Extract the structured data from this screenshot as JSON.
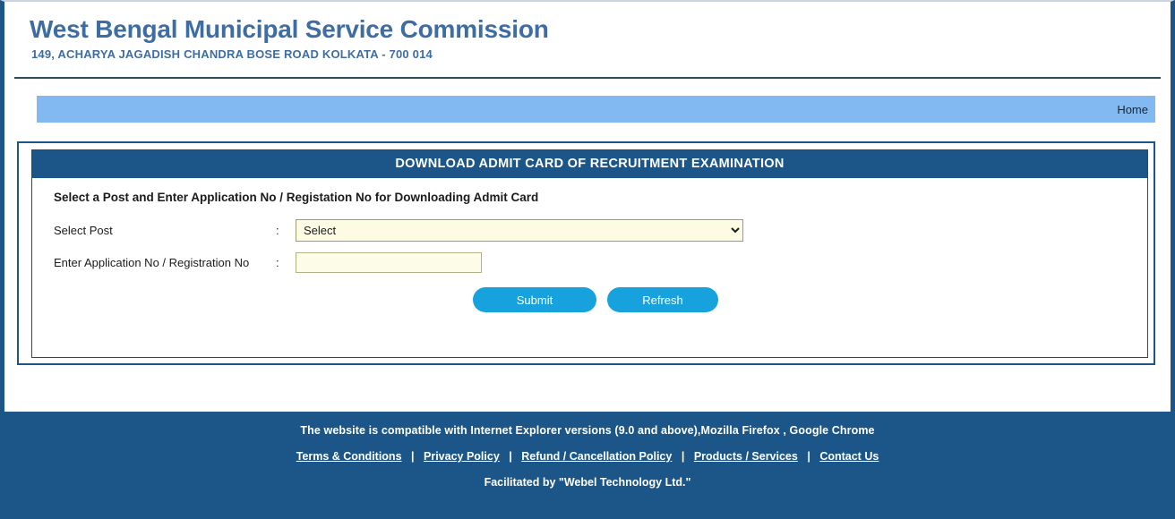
{
  "header": {
    "site_title": "West Bengal Municipal Service Commission",
    "address": "149, ACHARYA JAGADISH CHANDRA BOSE ROAD KOLKATA - 700 014"
  },
  "nav": {
    "items": [
      {
        "label": "Home"
      }
    ]
  },
  "panel": {
    "title": "DOWNLOAD ADMIT CARD OF RECRUITMENT EXAMINATION",
    "form_heading": "Select a Post and Enter Application No / Registation No for Downloading Admit Card",
    "fields": {
      "post": {
        "label": "Select Post",
        "colon": ":",
        "selected": "Select",
        "options": [
          "Select"
        ]
      },
      "application_no": {
        "label": "Enter Application No / Registration No",
        "colon": ":",
        "value": "",
        "placeholder": ""
      }
    },
    "buttons": {
      "submit": "Submit",
      "refresh": "Refresh"
    }
  },
  "footer": {
    "compatibility": "The website is compatible with Internet Explorer versions (9.0 and above),Mozilla Firefox , Google Chrome",
    "links": [
      {
        "label": "Terms & Conditions"
      },
      {
        "label": "Privacy Policy"
      },
      {
        "label": "Refund / Cancellation Policy"
      },
      {
        "label": "Products / Services"
      },
      {
        "label": "Contact Us"
      }
    ],
    "separator": "|",
    "facilitated": "Facilitated by \"Webel Technology Ltd.\""
  },
  "colors": {
    "brand_dark_blue": "#1c5689",
    "title_blue": "#3e6da4",
    "nav_blue": "#82b9f0",
    "button_blue": "#17a1dd",
    "field_ivory": "#fdfbe4"
  }
}
